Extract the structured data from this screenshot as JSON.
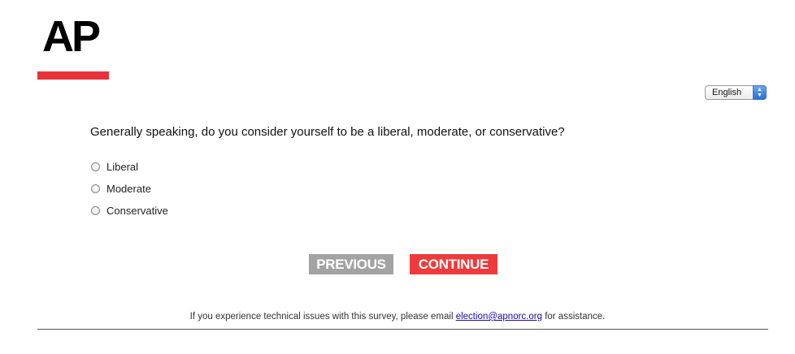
{
  "brand": {
    "logo_text": "AP",
    "accent_color": "#e8333a"
  },
  "language_select": {
    "selected": "English",
    "arrow_icon": "up-down-arrows-icon"
  },
  "question": {
    "text": "Generally speaking, do you consider yourself to be a liberal, moderate, or conservative?",
    "options": [
      {
        "label": "Liberal",
        "selected": false
      },
      {
        "label": "Moderate",
        "selected": false
      },
      {
        "label": "Conservative",
        "selected": false
      }
    ]
  },
  "buttons": {
    "previous_label": "PREVIOUS",
    "continue_label": "CONTINUE",
    "previous_color": "#a3a3a3",
    "continue_color": "#ee3a3a"
  },
  "footer": {
    "text_before": "If you experience technical issues with this survey, please email ",
    "email": "election@apnorc.org",
    "text_after": " for assistance."
  }
}
